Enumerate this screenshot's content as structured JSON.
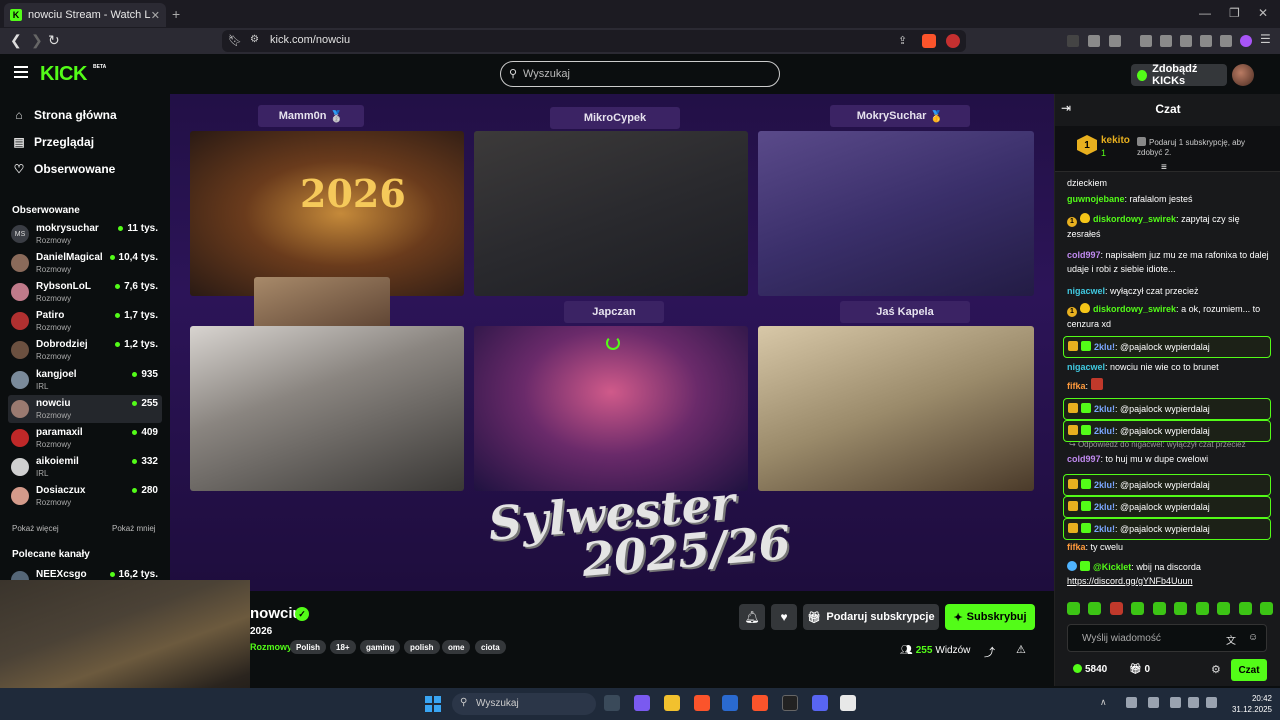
{
  "browser": {
    "tab_title": "nowciu Stream - Watch Live on Kick",
    "tab_close": "✕",
    "new_tab": "+",
    "url": "kick.com/nowciu",
    "window_controls": [
      "—",
      "❐",
      "✕"
    ]
  },
  "header": {
    "logo": "KICK",
    "beta": "BETA",
    "search_placeholder": "Wyszukaj",
    "kicks_button": "Zdobądź KICKs"
  },
  "sidebar": {
    "nav": [
      {
        "label": "Strona główna",
        "icon": "home-icon"
      },
      {
        "label": "Przeglądaj",
        "icon": "browse-icon"
      },
      {
        "label": "Obserwowane",
        "icon": "heart-icon"
      }
    ],
    "followed_heading": "Obserwowane",
    "channels": [
      {
        "name": "mokrysuchar",
        "category": "Rozmowy",
        "viewers": "11 tys.",
        "avatar_color": "#3a3d44",
        "avatar_text": "MS"
      },
      {
        "name": "DanielMagical",
        "category": "Rozmowy",
        "viewers": "10,4 tys.",
        "avatar_color": "#8a6a5a"
      },
      {
        "name": "RybsonLoL",
        "category": "Rozmowy",
        "viewers": "7,6 tys.",
        "avatar_color": "#c07a8a"
      },
      {
        "name": "Patiro",
        "category": "Rozmowy",
        "viewers": "1,7 tys.",
        "avatar_color": "#b03030"
      },
      {
        "name": "Dobrodziej",
        "category": "Rozmowy",
        "viewers": "1,2 tys.",
        "avatar_color": "#6b5040"
      },
      {
        "name": "kangjoel",
        "category": "IRL",
        "viewers": "935",
        "avatar_color": "#7a8a9a"
      },
      {
        "name": "nowciu",
        "category": "Rozmowy",
        "viewers": "255",
        "avatar_color": "#9a7a70"
      },
      {
        "name": "paramaxil",
        "category": "Rozmowy",
        "viewers": "409",
        "avatar_color": "#c02828"
      },
      {
        "name": "aikoiemil",
        "category": "IRL",
        "viewers": "332",
        "avatar_color": "#d0d0d0"
      },
      {
        "name": "Dosiaczux",
        "category": "Rozmowy",
        "viewers": "280",
        "avatar_color": "#d49a8a"
      }
    ],
    "show_more": "Pokaż więcej",
    "show_less": "Pokaż mniej",
    "recommended_heading": "Polecane kanały",
    "recommended": [
      {
        "name": "NEEXcsgo",
        "viewers": "16,2 tys.",
        "avatar_color": "#556677"
      }
    ]
  },
  "video": {
    "players": [
      "Mamm0n",
      "MikroCypek",
      "MokrySuchar",
      "Japczan",
      "Jaś Kapela"
    ],
    "medal": "🥈",
    "medal_gold": "🥇",
    "banner_line1": "Sylwester",
    "banner_line2": "2025/26",
    "tile_year": "2026"
  },
  "stream": {
    "streamer": "nowciu",
    "verified": "✓",
    "title": "2026",
    "category": "Rozmowy",
    "tags": [
      "Polish",
      "18+",
      "gaming",
      "polish",
      "ome",
      "ciota"
    ],
    "gift_button": "Podaruj subskrypcje",
    "subscribe_button": "Subskrybuj",
    "viewers": "255",
    "viewers_label": "Widzów"
  },
  "chat": {
    "title": "Czat",
    "pinned": {
      "user": "kekito",
      "rank": "1",
      "count": "1",
      "message": "Podaruj 1 subskrypcję, aby zdobyć 2."
    },
    "messages": [
      {
        "user": "",
        "text": "dzieckiem",
        "color": "#ffffff"
      },
      {
        "user": "guwnojebane",
        "text": "rafalalom jesteś",
        "color": "#53fc18"
      },
      {
        "user": "diskordowy_swirek",
        "text": "zapytaj czy się zesrałeś",
        "color": "#53fc18",
        "badges": [
          "one",
          "heart"
        ]
      },
      {
        "user": "cold997",
        "text": "napisałem juz mu ze ma rafonixa to dalej udaje i robi z siebie idiote...",
        "color": "#c08af0"
      },
      {
        "user": "nigacwel",
        "text": "wyłączył czat przecież",
        "color": "#40c9e0"
      },
      {
        "user": "diskordowy_swirek",
        "text": "a ok, rozumiem... to cenzura xd",
        "color": "#53fc18",
        "badges": [
          "one",
          "heart"
        ]
      },
      {
        "user": "2klu!",
        "text": "@pajalock wypierdalaj",
        "color": "#7aa6ff",
        "highlight": true,
        "badges": [
          "crown",
          "sub"
        ]
      },
      {
        "user": "nigacwel",
        "text": "nowciu nie wie co to brunet",
        "color": "#40c9e0"
      },
      {
        "user": "fifka",
        "text": "",
        "color": "#ff9a3c",
        "badges_after": [
          "emote"
        ]
      },
      {
        "user": "2klu!",
        "text": "@pajalock wypierdalaj",
        "color": "#7aa6ff",
        "highlight": true,
        "badges": [
          "crown",
          "sub"
        ]
      },
      {
        "user": "2klu!",
        "text": "@pajalock wypierdalaj",
        "color": "#7aa6ff",
        "highlight": true,
        "badges": [
          "crown",
          "sub"
        ]
      },
      {
        "reply": "Odpowiedź do nigacwel: wyłączył czat przecież"
      },
      {
        "user": "cold997",
        "text": "to huj mu w dupe cwelowi",
        "color": "#c08af0"
      },
      {
        "user": "2klu!",
        "text": "@pajalock wypierdalaj",
        "color": "#7aa6ff",
        "highlight": true,
        "badges": [
          "crown",
          "sub"
        ]
      },
      {
        "user": "2klu!",
        "text": "@pajalock wypierdalaj",
        "color": "#7aa6ff",
        "highlight": true,
        "badges": [
          "crown",
          "sub"
        ]
      },
      {
        "user": "2klu!",
        "text": "@pajalock wypierdalaj",
        "color": "#7aa6ff",
        "highlight": true,
        "badges": [
          "crown",
          "sub"
        ]
      },
      {
        "user": "fifka",
        "text": "ty cwelu",
        "color": "#ff9a3c"
      },
      {
        "user": "@Kicklet",
        "text": "wbij na discorda",
        "link": "https://discord.gg/gYNFb4Uuun",
        "color": "#53fc18",
        "badges": [
          "bot",
          "sub"
        ]
      }
    ],
    "input_placeholder": "Wyślij wiadomość",
    "points": "5840",
    "gifts": "0",
    "send_button": "Czat"
  },
  "taskbar": {
    "search_placeholder": "Wyszukaj",
    "time": "20:42",
    "date": "31.12.2025"
  },
  "colors": {
    "accent": "#53fc18",
    "background": "#0b0e0f",
    "chat_bg": "#18191b",
    "button_gray": "#34373a"
  }
}
